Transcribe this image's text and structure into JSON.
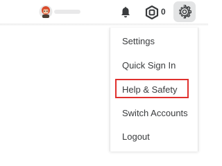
{
  "header": {
    "robux_count": "0"
  },
  "icons": {
    "avatar": "avatar-icon",
    "notifications": "bell-icon",
    "currency": "robux-icon",
    "settings": "gear-icon"
  },
  "settings_menu": {
    "items": [
      {
        "label": "Settings"
      },
      {
        "label": "Quick Sign In"
      },
      {
        "label": "Help & Safety"
      },
      {
        "label": "Switch Accounts"
      },
      {
        "label": "Logout"
      }
    ],
    "highlighted_item": "Help & Safety",
    "highlight_color": "#e0302d"
  }
}
